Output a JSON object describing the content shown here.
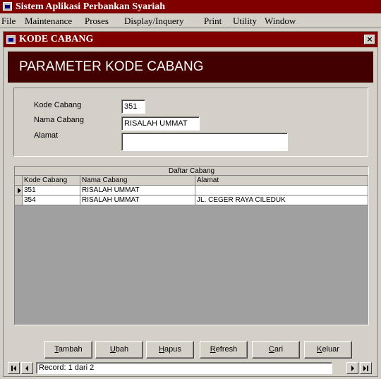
{
  "app": {
    "title": "Sistem Aplikasi Perbankan Syariah"
  },
  "menu": [
    "File",
    "Maintenance",
    "Proses",
    "Display/Inquery",
    "Print",
    "Utility",
    "Window"
  ],
  "window": {
    "title": "KODE CABANG",
    "close": "×"
  },
  "banner": {
    "text": "PARAMETER KODE CABANG"
  },
  "form": {
    "kode_label": "Kode Cabang",
    "kode_value": "351",
    "nama_label": "Nama Cabang",
    "nama_value": "RISALAH UMMAT",
    "alamat_label": "Alamat",
    "alamat_value": ""
  },
  "grid": {
    "caption": "Daftar Cabang",
    "columns": [
      "Kode Cabang",
      "Nama Cabang",
      "Alamat"
    ],
    "rows": [
      [
        "351",
        "RISALAH UMMAT",
        ""
      ],
      [
        "354",
        "RISALAH UMMAT",
        "JL. CEGER RAYA CILEDUK"
      ]
    ]
  },
  "buttons": [
    {
      "key": "T",
      "rest": "ambah"
    },
    {
      "key": "U",
      "rest": "bah"
    },
    {
      "key": "H",
      "rest": "apus"
    },
    {
      "key": "R",
      "rest": "efresh"
    },
    {
      "key": "C",
      "rest": "ari"
    },
    {
      "key": "K",
      "rest": "eluar"
    }
  ],
  "navigator": {
    "record_text": "Record: 1 dari 2"
  }
}
